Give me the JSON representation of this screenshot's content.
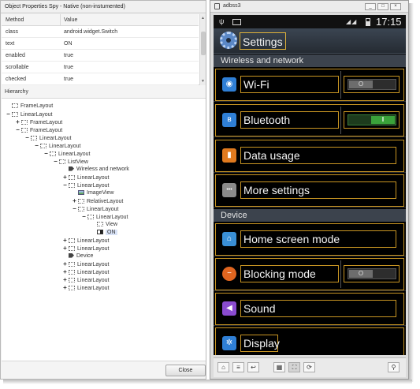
{
  "spy": {
    "title": "Object Properties Spy - Native (non-instumented)",
    "columns": {
      "method": "Method",
      "value": "Value"
    },
    "properties": [
      {
        "method": "class",
        "value": "android.widget.Switch"
      },
      {
        "method": "text",
        "value": "ON"
      },
      {
        "method": "enabled",
        "value": "true"
      },
      {
        "method": "scrollable",
        "value": "true"
      },
      {
        "method": "checked",
        "value": "true"
      }
    ],
    "hierarchy_label": "Hierarchy",
    "tree": [
      {
        "label": "FrameLayout",
        "exp": "",
        "icon": "box"
      },
      {
        "label": "LinearLayout",
        "exp": "−",
        "icon": "box"
      },
      {
        "label": "FrameLayout",
        "exp": "+",
        "icon": "box"
      },
      {
        "label": "FrameLayout",
        "exp": "−",
        "icon": "box"
      },
      {
        "label": "LinearLayout",
        "exp": "−",
        "icon": "box"
      },
      {
        "label": "LinearLayout",
        "exp": "−",
        "icon": "box"
      },
      {
        "label": "LinearLayout",
        "exp": "−",
        "icon": "box"
      },
      {
        "label": "ListView",
        "exp": "−",
        "icon": "box"
      },
      {
        "label": "Wireless and network",
        "exp": "",
        "icon": "tag"
      },
      {
        "label": "LinearLayout",
        "exp": "+",
        "icon": "box"
      },
      {
        "label": "LinearLayout",
        "exp": "−",
        "icon": "box"
      },
      {
        "label": "ImageView",
        "exp": "",
        "icon": "img"
      },
      {
        "label": "RelativeLayout",
        "exp": "+",
        "icon": "box"
      },
      {
        "label": "LinearLayout",
        "exp": "−",
        "icon": "box"
      },
      {
        "label": "LinearLayout",
        "exp": "−",
        "icon": "box"
      },
      {
        "label": "View",
        "exp": "",
        "icon": "box"
      },
      {
        "label": "ON",
        "exp": "",
        "icon": "sw"
      },
      {
        "label": "LinearLayout",
        "exp": "+",
        "icon": "box"
      },
      {
        "label": "LinearLayout",
        "exp": "+",
        "icon": "box"
      },
      {
        "label": "Device",
        "exp": "",
        "icon": "tag"
      },
      {
        "label": "LinearLayout",
        "exp": "+",
        "icon": "box"
      },
      {
        "label": "LinearLayout",
        "exp": "+",
        "icon": "box"
      },
      {
        "label": "LinearLayout",
        "exp": "+",
        "icon": "box"
      },
      {
        "label": "LinearLayout",
        "exp": "+",
        "icon": "box"
      }
    ],
    "close_label": "Close"
  },
  "device": {
    "window_title": "adbss3",
    "window_buttons": [
      "_",
      "□",
      "×"
    ],
    "status_time": "17:15",
    "action_title": "Settings",
    "sections": {
      "wireless": "Wireless and network",
      "device": "Device"
    },
    "items": [
      {
        "label": "Wi-Fi",
        "icon": "wifi-icon",
        "icon_color": "#2f7fd6",
        "glyph": "◉",
        "toggle": "off"
      },
      {
        "label": "Bluetooth",
        "icon": "bluetooth-icon",
        "icon_color": "#2f7fd6",
        "glyph": "ʙ",
        "toggle": "on"
      },
      {
        "label": "Data usage",
        "icon": "data-usage-icon",
        "icon_color": "#e07a1f",
        "glyph": "▮",
        "toggle": ""
      },
      {
        "label": "More settings",
        "icon": "more-settings-icon",
        "icon_color": "#8a8a8a",
        "glyph": "•••",
        "toggle": ""
      },
      {
        "label": "Home screen mode",
        "icon": "home-icon",
        "icon_color": "#3a8fd6",
        "glyph": "⌂",
        "toggle": ""
      },
      {
        "label": "Blocking mode",
        "icon": "blocking-icon",
        "icon_color": "#e0651f",
        "glyph": "−",
        "toggle": "off"
      },
      {
        "label": "Sound",
        "icon": "sound-icon",
        "icon_color": "#8a4bd0",
        "glyph": "◀",
        "toggle": ""
      },
      {
        "label": "Display",
        "icon": "display-icon",
        "icon_color": "#2f7fd6",
        "glyph": "✲",
        "toggle": ""
      }
    ],
    "toggle_on_text": "I",
    "toggle_off_text": "O"
  }
}
